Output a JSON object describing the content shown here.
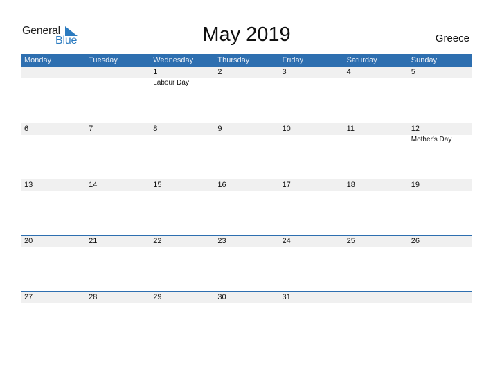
{
  "logo": {
    "line1": "General",
    "line2": "Blue",
    "accent": "#2b7bc0"
  },
  "title": "May 2019",
  "country": "Greece",
  "colors": {
    "header": "#2e6fb0",
    "date_strip": "#f0f0f0"
  },
  "weekdays": [
    "Monday",
    "Tuesday",
    "Wednesday",
    "Thursday",
    "Friday",
    "Saturday",
    "Sunday"
  ],
  "weeks": [
    {
      "dates": [
        "",
        "",
        "1",
        "2",
        "3",
        "4",
        "5"
      ],
      "events": [
        "",
        "",
        "Labour Day",
        "",
        "",
        "",
        ""
      ]
    },
    {
      "dates": [
        "6",
        "7",
        "8",
        "9",
        "10",
        "11",
        "12"
      ],
      "events": [
        "",
        "",
        "",
        "",
        "",
        "",
        "Mother's Day"
      ]
    },
    {
      "dates": [
        "13",
        "14",
        "15",
        "16",
        "17",
        "18",
        "19"
      ],
      "events": [
        "",
        "",
        "",
        "",
        "",
        "",
        ""
      ]
    },
    {
      "dates": [
        "20",
        "21",
        "22",
        "23",
        "24",
        "25",
        "26"
      ],
      "events": [
        "",
        "",
        "",
        "",
        "",
        "",
        ""
      ]
    },
    {
      "dates": [
        "27",
        "28",
        "29",
        "30",
        "31",
        "",
        ""
      ],
      "events": [
        "",
        "",
        "",
        "",
        "",
        "",
        ""
      ]
    }
  ]
}
